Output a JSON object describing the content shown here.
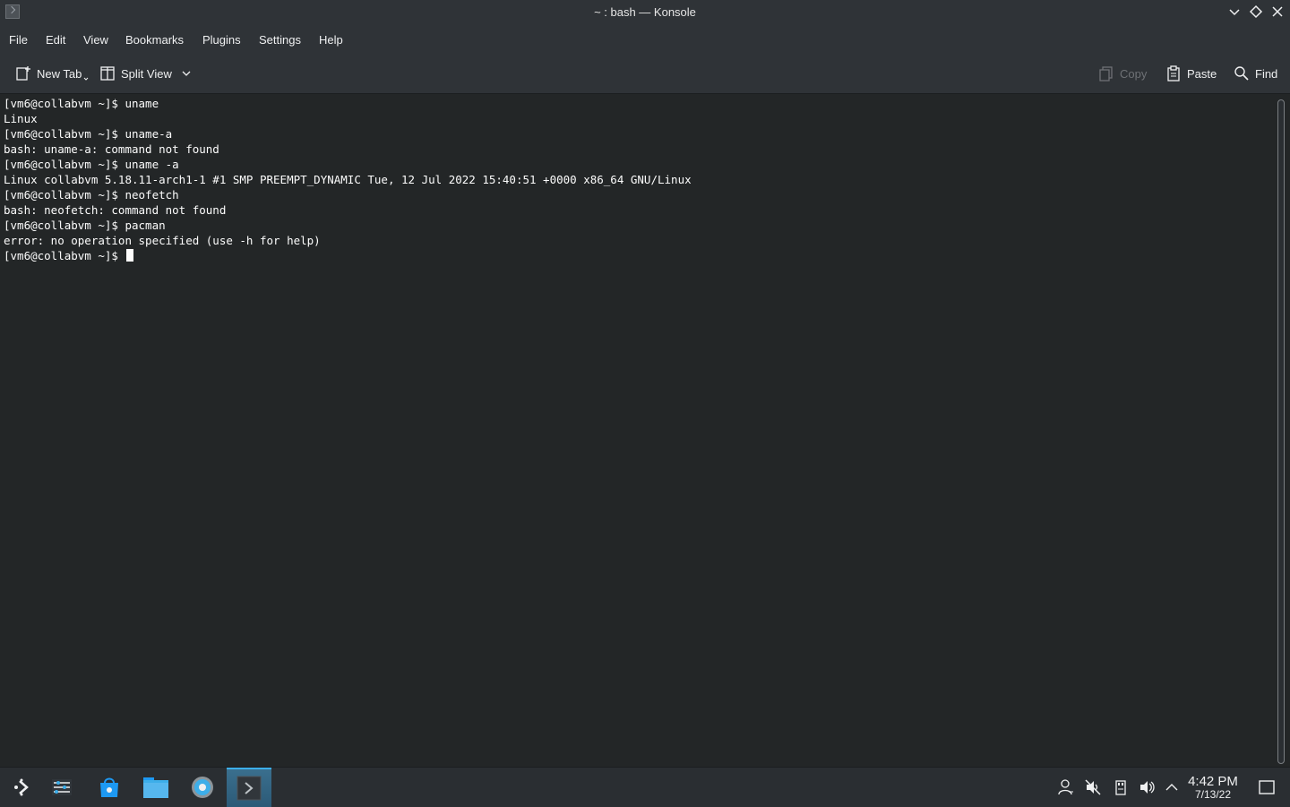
{
  "window": {
    "title": "~ : bash — Konsole"
  },
  "menubar": {
    "items": [
      "File",
      "Edit",
      "View",
      "Bookmarks",
      "Plugins",
      "Settings",
      "Help"
    ]
  },
  "toolbar": {
    "new_tab": "New Tab",
    "split_view": "Split View",
    "copy": "Copy",
    "paste": "Paste",
    "find": "Find"
  },
  "terminal": {
    "lines": [
      "[vm6@collabvm ~]$ uname",
      "Linux",
      "[vm6@collabvm ~]$ uname-a",
      "bash: uname-a: command not found",
      "[vm6@collabvm ~]$ uname -a",
      "Linux collabvm 5.18.11-arch1-1 #1 SMP PREEMPT_DYNAMIC Tue, 12 Jul 2022 15:40:51 +0000 x86_64 GNU/Linux",
      "[vm6@collabvm ~]$ neofetch",
      "bash: neofetch: command not found",
      "[vm6@collabvm ~]$ pacman",
      "error: no operation specified (use -h for help)",
      "[vm6@collabvm ~]$ "
    ]
  },
  "taskbar": {
    "apps": [
      "app-launcher-icon",
      "pager-icon",
      "discover-icon",
      "dolphin-icon",
      "system-settings-icon",
      "konsole-icon"
    ],
    "clock_time": "4:42 PM",
    "clock_date": "7/13/22"
  },
  "colors": {
    "accent": "#3daee9",
    "background": "#232627",
    "chrome": "#2f3337"
  }
}
